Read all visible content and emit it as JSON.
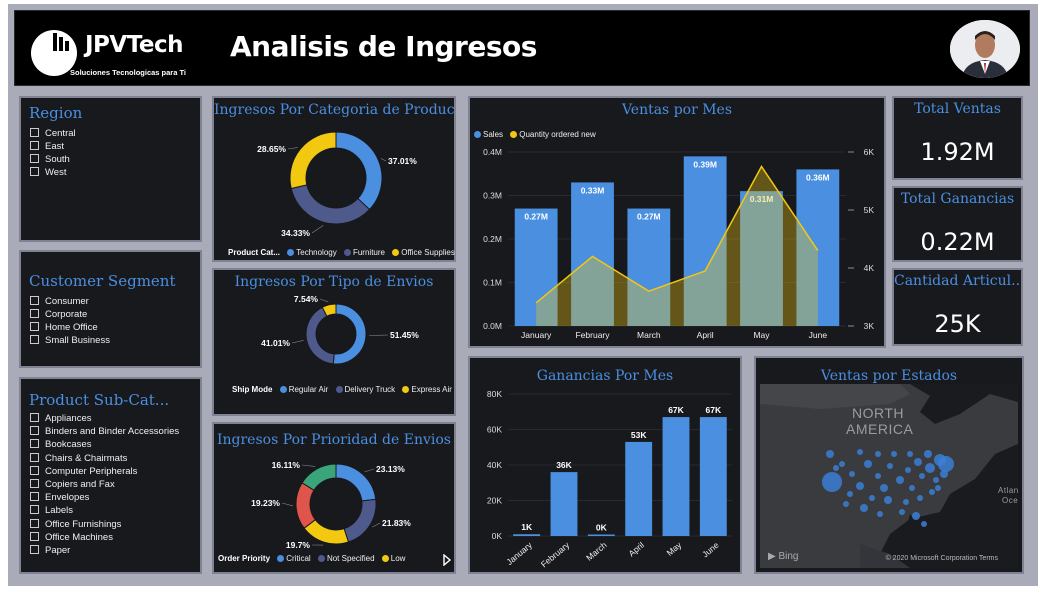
{
  "header": {
    "logo_text": "JPVTech",
    "logo_subtitle": "Soluciones Tecnologicas para Ti",
    "title": "Analisis de Ingresos"
  },
  "slicers": {
    "region": {
      "title": "Region",
      "items": [
        "Central",
        "East",
        "South",
        "West"
      ]
    },
    "segment": {
      "title": "Customer Segment",
      "items": [
        "Consumer",
        "Corporate",
        "Home Office",
        "Small Business"
      ]
    },
    "subcat": {
      "title": "Product Sub-Cat...",
      "items": [
        "Appliances",
        "Binders and Binder Accessories",
        "Bookcases",
        "Chairs & Chairmats",
        "Computer Peripherals",
        "Copiers and Fax",
        "Envelopes",
        "Labels",
        "Office Furnishings",
        "Office Machines",
        "Paper"
      ]
    }
  },
  "donut_categoria": {
    "title": "Ingresos Por Categoria de Produc...",
    "legend_title": "Product Cat...",
    "chart_data": {
      "type": "pie",
      "labels": [
        "Technology",
        "Furniture",
        "Office Supplies"
      ],
      "values": [
        37.01,
        34.33,
        28.65
      ],
      "value_labels": [
        "37.01%",
        "34.33%",
        "28.65%"
      ],
      "colors": [
        "#4a8fe0",
        "#4f5a8c",
        "#f2c811"
      ]
    }
  },
  "donut_envios": {
    "title": "Ingresos Por Tipo de Envios",
    "legend_title": "Ship Mode",
    "chart_data": {
      "type": "pie",
      "labels": [
        "Regular Air",
        "Delivery Truck",
        "Express Air"
      ],
      "values": [
        51.45,
        41.01,
        7.54
      ],
      "value_labels": [
        "51.45%",
        "41.01%",
        "7.54%"
      ],
      "colors": [
        "#4a8fe0",
        "#4f5a8c",
        "#f2c811"
      ]
    }
  },
  "donut_prioridad": {
    "title": "Ingresos Por Prioridad de  Envios",
    "legend_title": "Order Priority",
    "legend_items": [
      "Critical",
      "Not Specified",
      "Low"
    ],
    "chart_data": {
      "type": "pie",
      "values": [
        23.13,
        21.83,
        19.7,
        19.23,
        16.11
      ],
      "value_labels": [
        "23.13%",
        "21.83%",
        "19.7%",
        "19.23%",
        "16.11%"
      ],
      "colors": [
        "#4a8fe0",
        "#4f5a8c",
        "#f2c811",
        "#e0554b",
        "#3aa57a"
      ]
    }
  },
  "ventas_mes": {
    "title": "Ventas por Mes",
    "chart_data": {
      "type": "bar",
      "categories": [
        "January",
        "February",
        "March",
        "April",
        "May",
        "June"
      ],
      "series": [
        {
          "name": "Sales",
          "values": [
            0.27,
            0.33,
            0.27,
            0.39,
            0.31,
            0.36
          ],
          "labels": [
            "0.27M",
            "0.33M",
            "0.27M",
            "0.39M",
            "0.31M",
            "0.36M"
          ],
          "color": "#4a8fe0"
        },
        {
          "name": "Quantity ordered new",
          "values": [
            3.4,
            4.2,
            3.6,
            3.95,
            5.75,
            4.3
          ],
          "color": "#f2c811"
        }
      ],
      "ylim": [
        0,
        0.4
      ],
      "yticks": [
        "0.0M",
        "0.1M",
        "0.2M",
        "0.3M",
        "0.4M"
      ],
      "y2lim": [
        3,
        6
      ],
      "y2ticks": [
        "3K",
        "4K",
        "5K",
        "6K"
      ]
    }
  },
  "ganancias_mes": {
    "title": "Ganancias Por Mes",
    "chart_data": {
      "type": "bar",
      "categories": [
        "January",
        "February",
        "March",
        "April",
        "May",
        "June"
      ],
      "values": [
        1,
        36,
        0,
        53,
        67,
        67
      ],
      "labels": [
        "1K",
        "36K",
        "0K",
        "53K",
        "67K",
        "67K"
      ],
      "ylim": [
        0,
        80
      ],
      "yticks": [
        "0K",
        "20K",
        "40K",
        "60K",
        "80K"
      ],
      "color": "#4a8fe0"
    }
  },
  "kpis": [
    {
      "title": "Total Ventas",
      "value": "1.92M"
    },
    {
      "title": "Total Ganancias",
      "value": "0.22M"
    },
    {
      "title": "Cantidad Articul...",
      "value": "25K"
    }
  ],
  "map": {
    "title": "Ventas por Estados",
    "label_line1": "NORTH",
    "label_line2": "AMERICA",
    "edge_label1": "Atlan",
    "edge_label2": "Oce",
    "bing": "Bing",
    "copyright": "© 2020 Microsoft Corporation  Terms"
  }
}
